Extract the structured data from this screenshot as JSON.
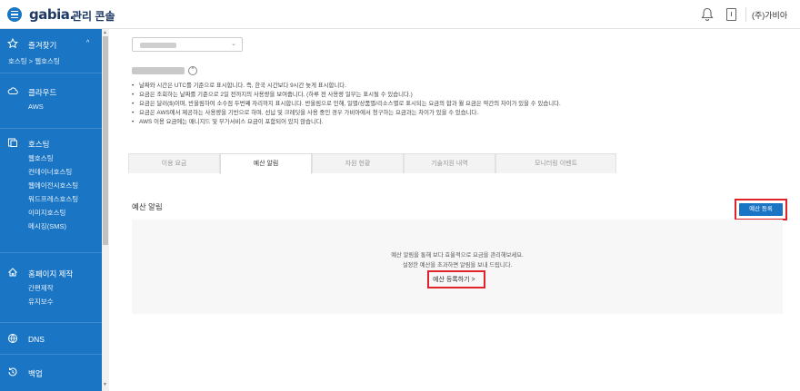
{
  "header": {
    "logo": "gabia.",
    "logo_sub": "관리 콘솔",
    "user": "(주)가비아"
  },
  "sidebar": {
    "favorites": {
      "label": "즐겨찾기",
      "chevron": "^",
      "item": "호스팅 > 웹호스팅"
    },
    "cloud": {
      "label": "클라우드",
      "items": [
        "AWS"
      ]
    },
    "hosting": {
      "label": "호스팅",
      "items": [
        "웹호스팅",
        "컨테이너호스팅",
        "웹에이전시호스팅",
        "워드프레스호스팅",
        "이미지호스팅",
        "메시징(SMS)"
      ]
    },
    "homepage": {
      "label": "홈페이지 제작",
      "items": [
        "간편제작",
        "유지보수"
      ]
    },
    "dns": {
      "label": "DNS"
    },
    "backup": {
      "label": "백업"
    }
  },
  "main": {
    "select_caret": "⌄",
    "toggle_icon": "^",
    "notes": [
      "날짜와 시간은 UTC를 기준으로 표시합니다. 즉, 한국 시간보다 9시간 늦게 표시합니다.",
      "요금은 조회하는 날짜를 기준으로 2일 전까지의 사용량을 보여줍니다. (하루 전 사용량 일부는 표시될 수 있습니다.)",
      "요금은 달러($)이며, 반올림하여 소수점 두번째 자리까지 표시합니다. 반올림으로 인해, 일별/상품별/리소스별로 표시되는 요금의 합과 월 요금은 약간의 차이가 있을 수 있습니다.",
      "요금은 AWS에서 제공하는 사용량을 기반으로 하며, 선납 및 크레딧을 사용 중인 경우 가비아에서 청구하는 요금과는 차이가 있을 수 있습니다.",
      "AWS 이용 요금에는 매니지드 및 부가서비스 요금이 포함되어 있지 않습니다."
    ],
    "tabs": [
      "이용 요금",
      "예산 알림",
      "자원 현황",
      "기술지원 내역",
      "모니터링 이벤트"
    ],
    "section_title": "예산 알림",
    "register_button": "예산 등록",
    "empty_msg1": "예산 알림을 통해 보다 효율적으로 요금을 관리해보세요.",
    "empty_msg2": "설정한 예산을 초과하면 알림을 보내 드립니다.",
    "register_link": "예산 등록하기  >"
  },
  "colors": {
    "brand": "#1a75c4",
    "highlight": "#e0232b"
  }
}
